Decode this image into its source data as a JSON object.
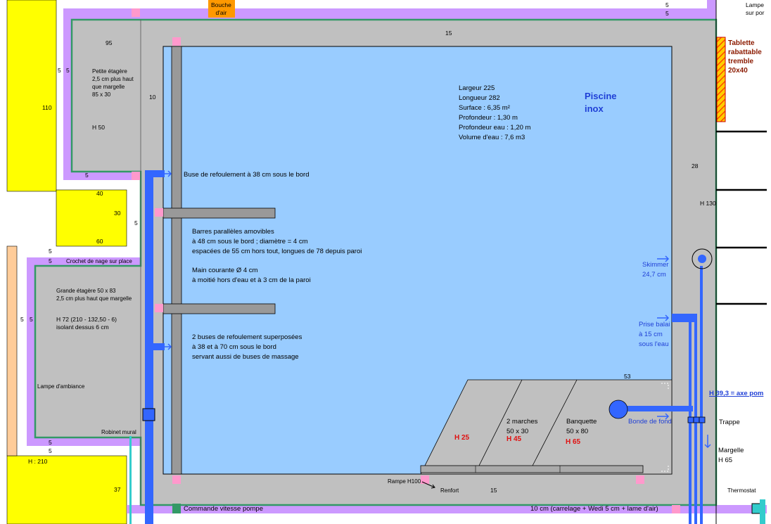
{
  "pool": {
    "title": "Piscine\ninox",
    "specs": [
      "Largeur 225",
      "Longueur 282",
      "Surface : 6,35 m²",
      "Profondeur : 1,30 m",
      "Profondeur eau : 1,20 m",
      "Volume d'eau : 7,6 m3"
    ]
  },
  "top": {
    "air_vent": "Bouche\nd'air",
    "lamp": "Lampe\nsur por",
    "dim_5a": "5",
    "dim_5b": "5",
    "dim_15": "15",
    "dim_28": "28",
    "h130": "H 130"
  },
  "shelf_small": {
    "dim_95": "95",
    "dim_5a": "5",
    "dim_5b": "5",
    "dim_10": "10",
    "text": "Petite étagère\n2,5 cm plus haut\nque margelle\n85 x 30",
    "h": "H 50",
    "dim_110": "110",
    "dim_5c": "5"
  },
  "yellow_mid": {
    "d40": "40",
    "d30": "30",
    "d5": "5",
    "d60": "60"
  },
  "shelf_large": {
    "d5a": "5",
    "d5b": "5",
    "crochet": "Crochet de nage sur place",
    "text": "Grande étagère 50 x 83\n2,5 cm plus haut que margelle",
    "h": "H 72 (210 - 132,50 - 6)\nisolant dessus 6 cm",
    "lamp": "Lampe d'ambiance",
    "tap": "Robinet mural",
    "d5c": "5",
    "d5d": "5",
    "side5a": "5",
    "side5b": "5"
  },
  "bottom_left": {
    "h210": "H : 210",
    "d37": "37"
  },
  "nozzles": {
    "top": "Buse de refoulement à 38 cm sous le bord",
    "bars": "Barres parallèles amovibles\nà 48 cm sous le bord ; diamètre = 4 cm\nespacées de 55 cm hors tout, longues de 78 depuis paroi",
    "handrail": "Main courante Ø 4 cm\nà moitié hors d'eau et à 3 cm de la paroi",
    "double": "2 buses de refoulement superposées\nà 38 et à 70 cm sous le bord\nservant aussi de buses de massage"
  },
  "right": {
    "skimmer": "Skimmer\n24,7 cm",
    "prise": "Prise balai\nà 15 cm\nsous l'eau",
    "d53": "53",
    "bonde": "Bonde de fond",
    "h393": "H 39,3 = axe pom",
    "trappe": "Trappe",
    "margelle": "Margelle\nH 65",
    "thermostat": "Thermostat",
    "tablette": "Tablette\nrabattable\ntremble\n20x40"
  },
  "steps": {
    "h25": "H 25",
    "marches": "2 marches\n50 x 30",
    "h45": "H 45",
    "banquette": "Banquette\n50 x 80",
    "h65": "H 65"
  },
  "bottom": {
    "rampe": "Rampe H100",
    "renfort": "Renfort",
    "d15": "15",
    "pump": "Commande vitesse pompe",
    "floor": "10 cm (carrelage + Wedi 5 cm + lame d'air)"
  },
  "colors": {
    "water": "#99ccff",
    "deck": "#c0c0c0",
    "wall": "#cc99ff",
    "yellow": "#ffff00",
    "outline": "#339966",
    "pipe": "#3366ff",
    "peach": "#ffcc99",
    "orange": "#ff9900"
  }
}
